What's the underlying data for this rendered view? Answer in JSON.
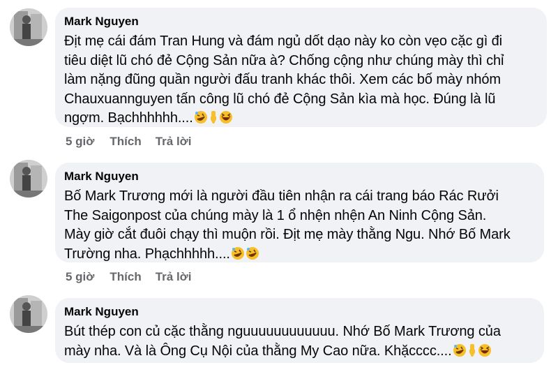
{
  "comments": [
    {
      "author": "Mark Nguyen",
      "text": "Địt mẹ cái đám Tran Hung và đám ngủ dốt dạo này ko còn vẹo cặc gì đi\ntiêu diệt lũ chó đẻ Cộng Sản nữa à? Chống cộng như chúng mày thì chỉ\nlàm nặng đũng quần người đấu tranh khác thôi. Xem các bố mày nhóm\nChauxuannguyen tấn công lũ chó đẻ Cộng Sản kìa mà học. Đúng là lũ\nngợm. Bạchhhhhh....",
      "emojis": [
        "rolling-on-floor-laughing",
        "backhand-index-pointing-down",
        "grinning-squinting-face"
      ],
      "time": "5 giờ",
      "like_label": "Thích",
      "reply_label": "Trả lời"
    },
    {
      "author": "Mark Nguyen",
      "text": "Bố Mark Trương mới là người đầu tiên nhận ra cái trang báo Rác Rưởi\nThe Saigonpost của chúng mày là 1 ổ nhện nhện An Ninh Cộng Sản.\nMày giờ cắt đuôi chạy thì muộn rồi. Địt mẹ mày thằng Ngu. Nhớ Bố Mark\nTrường nha. Phạchhhhh....",
      "emojis": [
        "rolling-on-floor-laughing",
        "rolling-on-floor-laughing"
      ],
      "time": "5 giờ",
      "like_label": "Thích",
      "reply_label": "Trả lời"
    },
    {
      "author": "Mark Nguyen",
      "text": "Bút thép con củ cặc thằng nguuuuuuuuuuuu. Nhớ Bố Mark Trương của\nmày nha. Và là Ông Cụ Nội của thằng My Cao nữa. Khặcccc....",
      "emojis": [
        "rolling-on-floor-laughing",
        "backhand-index-pointing-down",
        "grinning-squinting-face"
      ]
    }
  ],
  "colors": {
    "bubble": "#f0f2f5",
    "text": "#050505",
    "meta": "#65676b",
    "emoji_yellow": "#f7c02b"
  }
}
